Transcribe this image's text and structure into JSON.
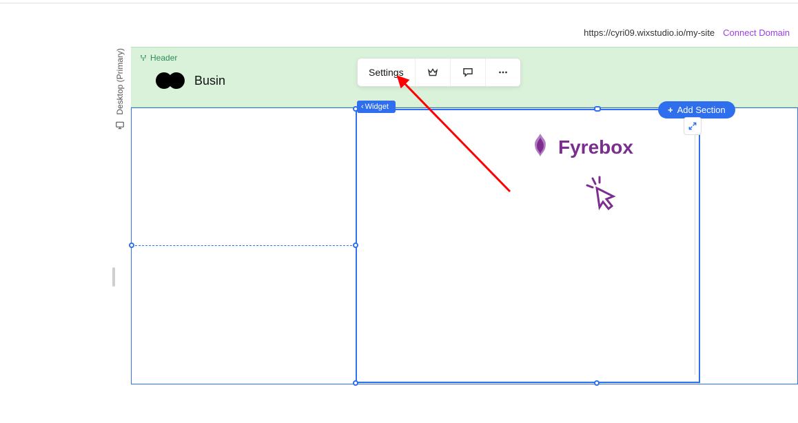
{
  "rail": {
    "label": "Desktop (Primary)"
  },
  "url": "https://cyri09.wixstudio.io/my-site",
  "connect_domain_label": "Connect Domain",
  "header": {
    "badge": "Header",
    "business_name": "Busin"
  },
  "toolbar": {
    "settings_label": "Settings",
    "crown_icon": "crown-icon",
    "comment_icon": "comment-icon",
    "more_icon": "more-icon"
  },
  "widget_tag": "Widget",
  "add_section_label": "Add Section",
  "brand_name": "Fyrebox",
  "colors": {
    "primary_blue": "#2F6FED",
    "header_green": "#D9F2D9",
    "purple": "#7B2E8E",
    "brand_purple_text": "#9B3DEA",
    "arrow_red": "#FF0000"
  }
}
